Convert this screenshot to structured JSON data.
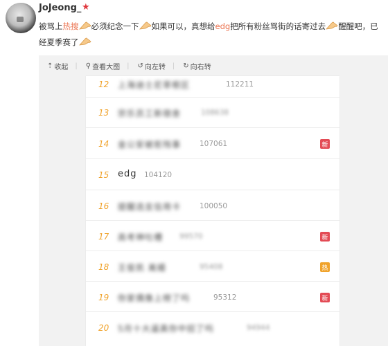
{
  "user": {
    "name": "JoJeong_"
  },
  "post": {
    "seg1": "被骂上",
    "seg_hot": "热搜",
    "seg2": "必须纪念一下",
    "seg3": "如果可以，真想给",
    "seg_link": "edg",
    "seg4": "把所有粉丝骂街的话寄过去",
    "seg5": "醒醒吧，已",
    "seg6": "经夏季赛了"
  },
  "toolbar": {
    "collapse": "收起",
    "view_large": "查看大图",
    "rotate_left": "向左转",
    "rotate_right": "向右转"
  },
  "trending": [
    {
      "rank": "12",
      "keyword": "上海迪士尼草根区",
      "count": "112211",
      "badge": ""
    },
    {
      "rank": "13",
      "keyword": "宗乐员工新宿舍",
      "count": "108638",
      "badge": ""
    },
    {
      "rank": "14",
      "keyword": "金公安被拒残事",
      "count": "107061",
      "badge": "新"
    },
    {
      "rank": "15",
      "keyword": "edg",
      "count": "104120",
      "badge": ""
    },
    {
      "rank": "16",
      "keyword": "提醒选支信用卡",
      "count": "100050",
      "badge": ""
    },
    {
      "rank": "17",
      "keyword": "高考神吐槽",
      "count": "99570",
      "badge": "新"
    },
    {
      "rank": "18",
      "keyword": "王俊凯 离婚",
      "count": "95408",
      "badge": "热"
    },
    {
      "rank": "19",
      "keyword": "你家偶像上榜了吗",
      "count": "95312",
      "badge": "新"
    },
    {
      "rank": "20",
      "keyword": "5月十大逼真你中招了吗",
      "count": "94944",
      "badge": ""
    }
  ],
  "colors": {
    "rank": "#f0a32c",
    "badge_new": "#e34b55",
    "badge_hot": "#f0a32c",
    "accent": "#eb7350"
  }
}
